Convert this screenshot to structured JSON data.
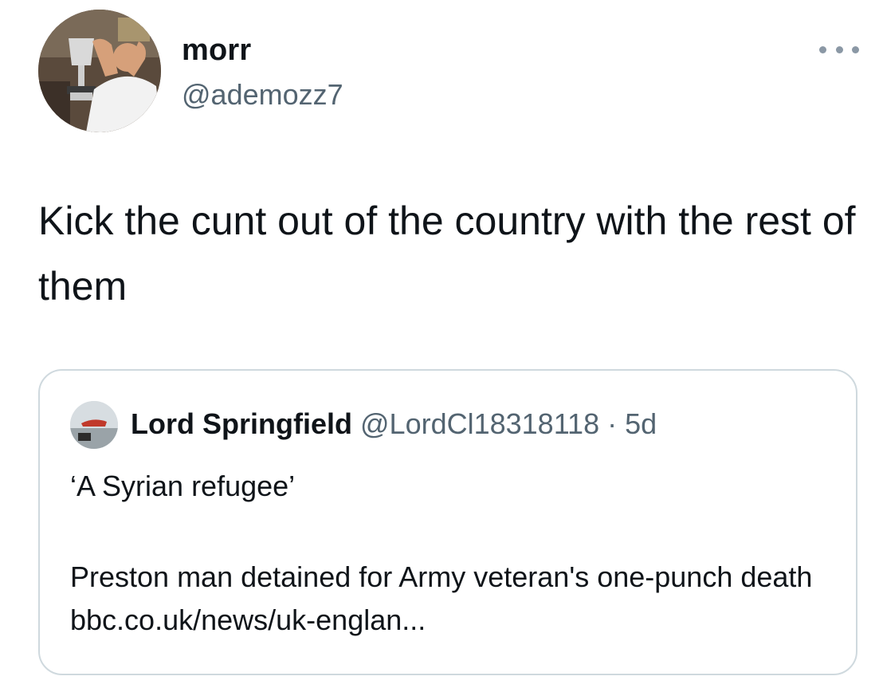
{
  "tweet": {
    "display_name": "morr",
    "handle": "@ademozz7",
    "text": "Kick the cunt out of the country with the rest of them"
  },
  "quoted_tweet": {
    "display_name": "Lord Springfield",
    "handle": "@LordCl18318118",
    "separator": "·",
    "time": "5d",
    "line1": "‘A Syrian refugee’",
    "body": "Preston man detained for Army veteran's one-punch death bbc.co.uk/news/uk-englan..."
  },
  "icons": {
    "more": "more-horizontal-icon"
  },
  "colors": {
    "primary_text": "#0f1419",
    "secondary_text": "#536471",
    "border": "#cfd9de"
  }
}
